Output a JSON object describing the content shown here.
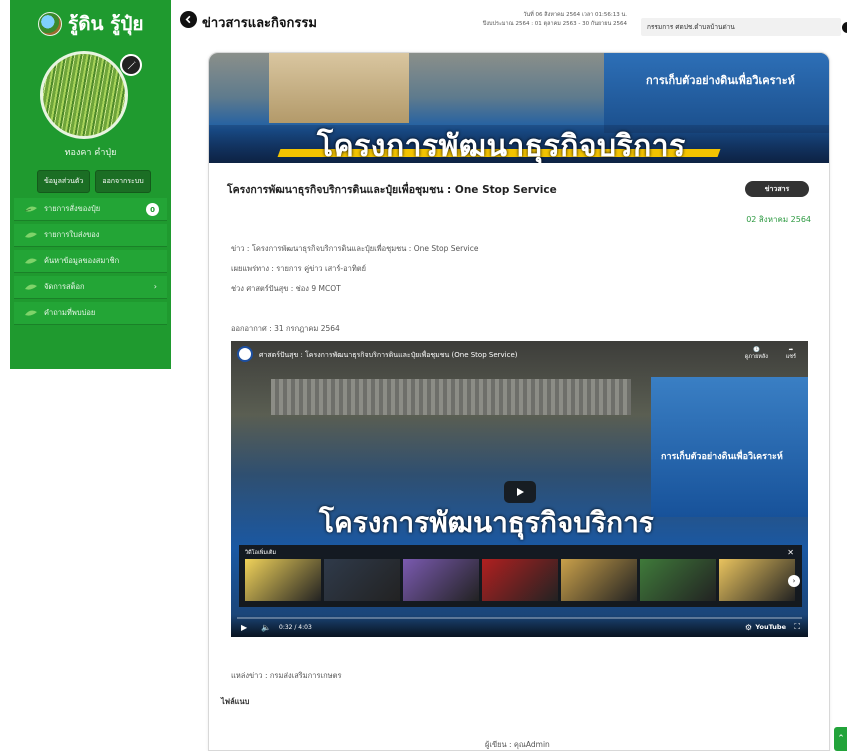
{
  "sidebar": {
    "brand": "รู้ดิน รู้ปุ๋ย",
    "user_name": "ทองคา คำปุ่ย",
    "profile_button": "ข้อมูลส่วนตัว",
    "logout_button": "ออกจากระบบ",
    "menu": [
      {
        "label": "รายการสั่งของปุ๋ย",
        "badge": "0"
      },
      {
        "label": "รายการใบส่งของ"
      },
      {
        "label": "ค้นหาข้อมูลของสมาชิก"
      },
      {
        "label": "จัดการสต็อก",
        "chevron": "›"
      },
      {
        "label": "คำถามที่พบบ่อย"
      }
    ]
  },
  "header": {
    "title": "ข่าวสารและกิจกรรม",
    "datetime": "วันที่ 06 สิงหาคม 2564 เวลา 01:56:13 น.",
    "fiscal_year": "ปีงบประมาณ 2564 : 01 ตุลาคม 2563 - 30 กันยายน 2564",
    "department": "กรรมการ ศดปช.ตำบลบ้านด่าน"
  },
  "banner": {
    "title": "โครงการพัฒนาธุรกิจบริการ",
    "sign_right": "การเก็บตัวอย่างดินเพื่อวิเคราะห์"
  },
  "article": {
    "title": "โครงการพัฒนาธุรกิจบริการดินและปุ๋ยเพื่อชุมชน : One Stop Service",
    "tag": "ข่าวสาร",
    "date": "02 สิงหาคม 2564",
    "lines": [
      "ข่าว : โครงการพัฒนาธุรกิจบริการดินและปุ๋ยเพื่อชุมชน : One Stop Service",
      "เผยแพร่ทาง : รายการ คู่ข่าว เสาร์-อาทิตย์",
      "ช่วง ศาสตร์ปันสุข : ช่อง 9 MCOT"
    ],
    "aired": "ออกอากาศ : 31 กรกฎาคม 2564",
    "source": "แหล่งข่าว : กรมส่งเสริมการเกษตร",
    "attachments": "ไฟล์แนบ",
    "author": "ผู้เขียน : คุณAdmin"
  },
  "video": {
    "title": "ศาสตร์ปันสุข : โครงการพัฒนาธุรกิจบริการดินและปุ๋ยเพื่อชุมชน (One Stop Service)",
    "watch_later": "ดูภายหลัง",
    "share": "แชร์",
    "big_title": "โครงการพัฒนาธุรกิจบริการ",
    "sign_text": "การเก็บตัวอย่างดินเพื่อวิเคราะห์",
    "related_label": "วิดีโอเพิ่มเติม",
    "time": "0:32 / 4:03",
    "youtube": "YouTube",
    "thumb_colors": [
      "#f0d25a",
      "#2f3a4a",
      "#7a5ab0",
      "#b02020",
      "#c9a04a",
      "#3f7a3a",
      "#e9c35e"
    ]
  },
  "icons": {
    "edit": "pencil-icon",
    "back": "chevron-left-icon",
    "leaf": "leaf-icon",
    "play": "play-icon"
  },
  "colors": {
    "sidebar": "#1f9a2f",
    "accent_date": "#2e9a42"
  }
}
